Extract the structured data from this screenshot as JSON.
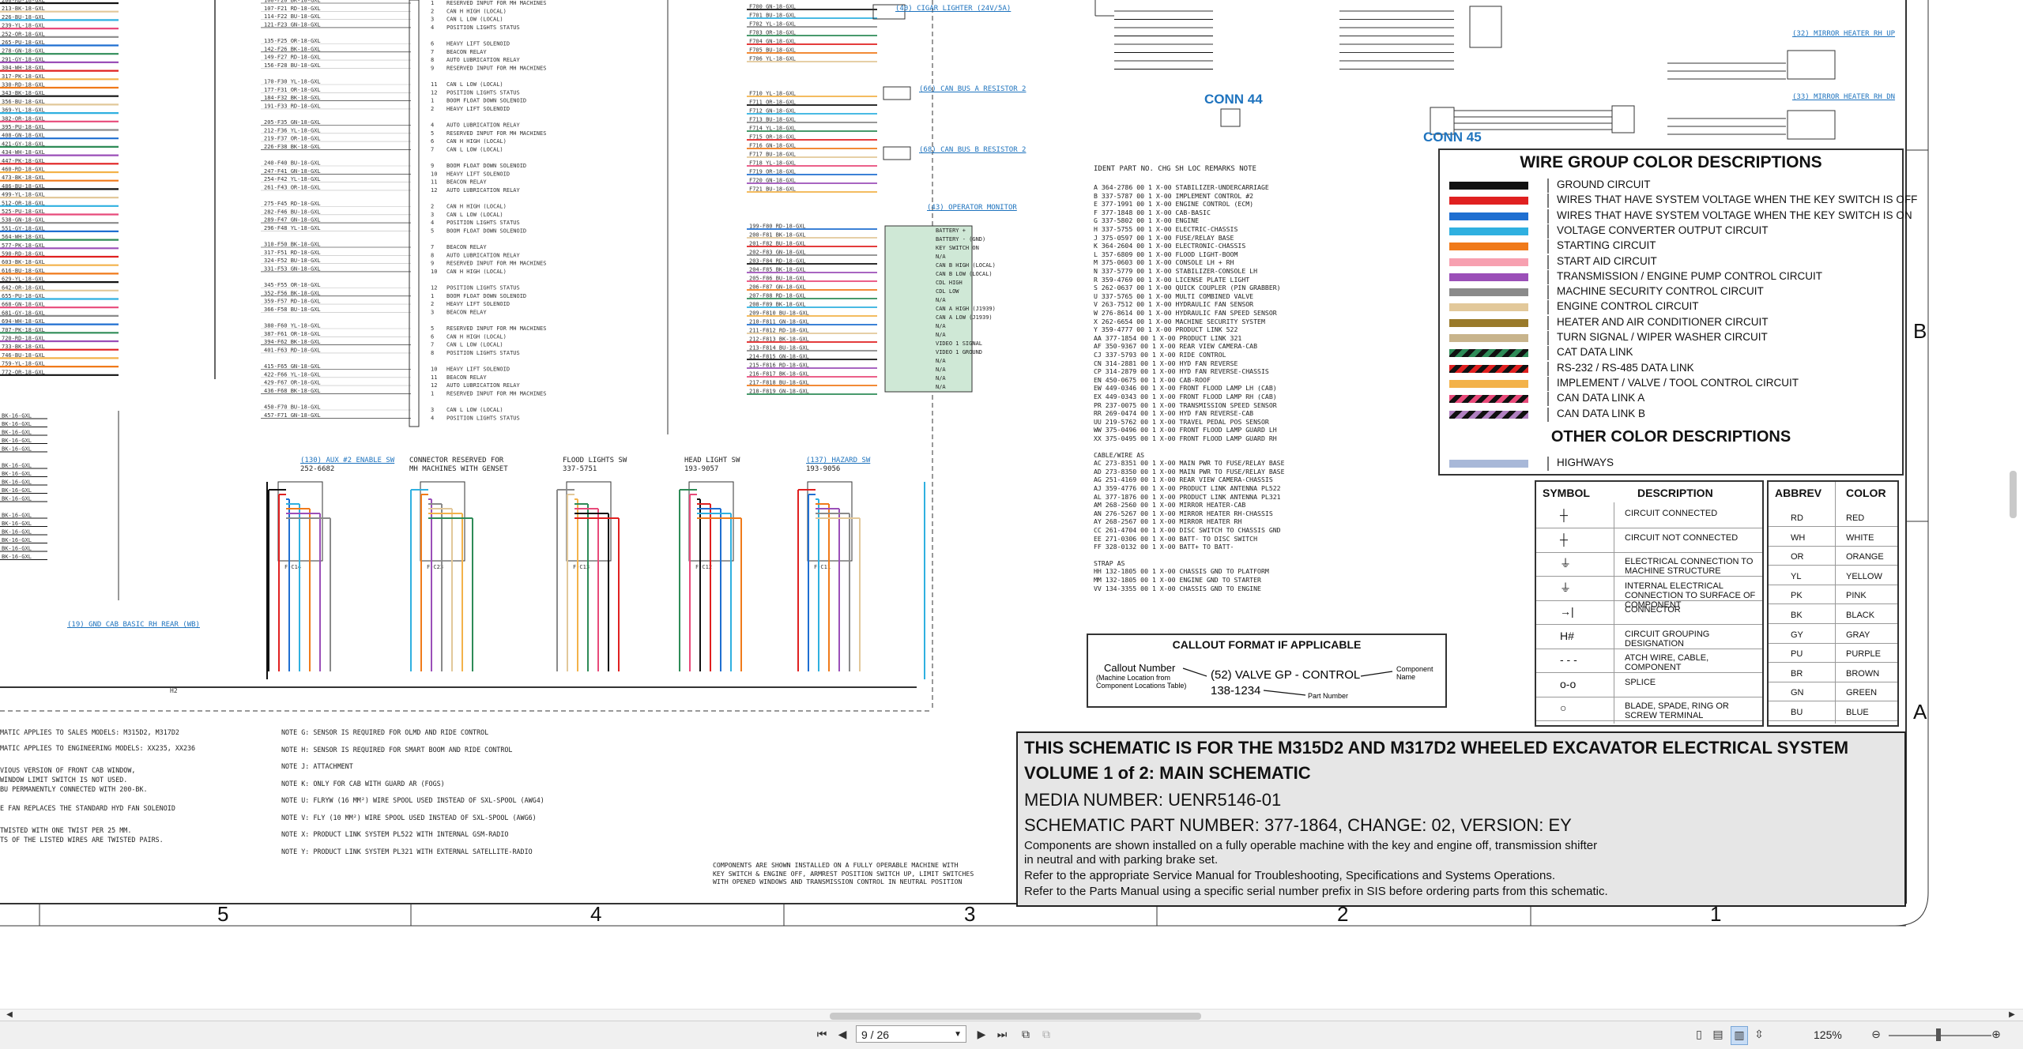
{
  "wire_groups": {
    "title": "WIRE GROUP COLOR DESCRIPTIONS",
    "rows": [
      {
        "label": "GROUND CIRCUIT",
        "c1": "#111111",
        "c2": "#111111"
      },
      {
        "label": "WIRES THAT HAVE SYSTEM VOLTAGE WHEN THE KEY SWITCH IS OFF",
        "c1": "#e02020",
        "c2": "#e02020"
      },
      {
        "label": "WIRES THAT HAVE SYSTEM VOLTAGE WHEN THE KEY SWITCH IS ON",
        "c1": "#1f6fd1",
        "c2": "#1f6fd1"
      },
      {
        "label": "VOLTAGE CONVERTER OUTPUT CIRCUIT",
        "c1": "#2fb0e0",
        "c2": "#2fb0e0"
      },
      {
        "label": "STARTING CIRCUIT",
        "c1": "#f07a1a",
        "c2": "#f07a1a"
      },
      {
        "label": "START AID CIRCUIT",
        "c1": "#f7a0b0",
        "c2": "#f7a0b0"
      },
      {
        "label": "TRANSMISSION / ENGINE PUMP CONTROL CIRCUIT",
        "c1": "#9b4fb8",
        "c2": "#9b4fb8"
      },
      {
        "label": "MACHINE SECURITY CONTROL CIRCUIT",
        "c1": "#8a8a8a",
        "c2": "#8a8a8a"
      },
      {
        "label": "ENGINE CONTROL CIRCUIT",
        "c1": "#e2c89a",
        "c2": "#e2c89a"
      },
      {
        "label": "HEATER AND AIR CONDITIONER CIRCUIT",
        "c1": "#9a7a2a",
        "c2": "#9a7a2a"
      },
      {
        "label": "TURN SIGNAL / WIPER WASHER CIRCUIT",
        "c1": "#c8b48c",
        "c2": "#c8b48c"
      },
      {
        "label": "CAT DATA LINK",
        "c1": "#2e8b57",
        "c2": "#111111"
      },
      {
        "label": "RS-232 / RS-485 DATA LINK",
        "c1": "#e02020",
        "c2": "#111111"
      },
      {
        "label": "IMPLEMENT / VALVE / TOOL CONTROL CIRCUIT",
        "c1": "#f3b24a",
        "c2": "#f3b24a"
      },
      {
        "label": "CAN DATA LINK A",
        "c1": "#e84a7a",
        "c2": "#111111"
      },
      {
        "label": "CAN DATA LINK B",
        "c1": "#b080c0",
        "c2": "#111111"
      }
    ],
    "other_title": "OTHER COLOR DESCRIPTIONS",
    "other_rows": [
      {
        "label": "HIGHWAYS",
        "c1": "#a8b8d8",
        "c2": "#a8b8d8"
      }
    ]
  },
  "symbols": {
    "header_symbol": "SYMBOL",
    "header_desc": "DESCRIPTION",
    "rows": [
      {
        "icon": "circuit-connected-icon",
        "label": "CIRCUIT CONNECTED"
      },
      {
        "icon": "circuit-not-connected-icon",
        "label": "CIRCUIT NOT CONNECTED"
      },
      {
        "icon": "machine-ground-icon",
        "label": "ELECTRICAL CONNECTION TO MACHINE STRUCTURE"
      },
      {
        "icon": "component-ground-icon",
        "label": "INTERNAL ELECTRICAL CONNECTION TO SURFACE OF COMPONENT"
      },
      {
        "icon": "connector-icon",
        "label": "CONNECTOR"
      },
      {
        "icon": "circuit-grouping-icon",
        "label": "CIRCUIT GROUPING DESIGNATION"
      },
      {
        "icon": "attach-wire-icon",
        "label": "ATCH WIRE, CABLE, COMPONENT"
      },
      {
        "icon": "splice-icon",
        "label": "SPLICE"
      },
      {
        "icon": "terminal-icon",
        "label": "BLADE, SPADE, RING OR SCREW TERMINAL"
      }
    ]
  },
  "abbreviations": {
    "header_abbrev": "ABBREV",
    "header_color": "COLOR",
    "rows": [
      [
        "RD",
        "RED"
      ],
      [
        "WH",
        "WHITE"
      ],
      [
        "OR",
        "ORANGE"
      ],
      [
        "YL",
        "YELLOW"
      ],
      [
        "PK",
        "PINK"
      ],
      [
        "BK",
        "BLACK"
      ],
      [
        "GY",
        "GRAY"
      ],
      [
        "PU",
        "PURPLE"
      ],
      [
        "BR",
        "BROWN"
      ],
      [
        "GN",
        "GREEN"
      ],
      [
        "BU",
        "BLUE"
      ]
    ]
  },
  "callout": {
    "title": "CALLOUT FORMAT IF APPLICABLE",
    "callout_number": "Callout Number",
    "machine_location": "(Machine Location from",
    "component_locations": "Component Locations Table)",
    "example": "(52) VALVE GP - CONTROL",
    "part_example": "138-1234",
    "component_name": "Component Name",
    "part_number": "Part Number"
  },
  "title_block": {
    "line1": "THIS SCHEMATIC IS FOR THE M315D2 AND M317D2  WHEELED EXCAVATOR ELECTRICAL SYSTEM",
    "line2": "VOLUME 1 of 2: MAIN SCHEMATIC",
    "media": "MEDIA NUMBER: UENR5146-01",
    "part": "SCHEMATIC PART NUMBER: 377-1864, CHANGE: 02, VERSION: EY",
    "note1": "Components are shown installed on a fully operable machine with the key and engine off, transmission shifter",
    "note2": "in neutral and with parking brake set.",
    "note3": "Refer to the appropriate Service Manual for Troubleshooting, Specifications and Systems Operations.",
    "note4": "Refer to the Parts Manual using a specific serial number prefix in SIS before ordering parts from this schematic."
  },
  "zones": {
    "bottom": [
      "5",
      "4",
      "3",
      "2",
      "1"
    ],
    "right": [
      "B",
      "A"
    ]
  },
  "conn_labels": {
    "conn44": "CONN 44",
    "conn45": "CONN 45"
  },
  "links": {
    "cigar": "(40) CIGAR LIGHTER (24V/5A)",
    "can_resistor_a": "(66) CAN BUS A RESISTOR 2",
    "can_resistor_b": "(68) CAN BUS B RESISTOR 2",
    "operator_monitor": "(43) OPERATOR MONITOR",
    "aux_enable": "(130) AUX #2 ENABLE SW",
    "hazard": "(137) HAZARD SW",
    "gnd_cab": "(19) GND CAB BASIC RH REAR (WB)",
    "mirror_upper": "(32) MIRROR HEATER RH UP",
    "mirror_lower": "(33) MIRROR HEATER RH DN"
  },
  "switch_labels": {
    "reserved": "CONNECTOR RESERVED FOR",
    "reserved2": "MH MACHINES WITH GENSET",
    "flood": "FLOOD LIGHTS SW",
    "head": "HEAD LIGHT SW",
    "flood_pn": "337-5751",
    "head_pn": "193-9057",
    "hazard_pn": "193-9056",
    "aux_pn": "252-6682"
  },
  "notes_left": [
    "MATIC APPLIES TO SALES MODELS: M315D2, M317D2",
    "MATIC APPLIES TO ENGINEERING MODELS: XX235, XX236",
    "VIOUS VERSION OF FRONT CAB WINDOW,",
    "WINDOW LIMIT SWITCH IS NOT USED.",
    "BU PERMANENTLY CONNECTED WITH 200-BK.",
    "E FAN REPLACES THE STANDARD HYD FAN SOLENOID",
    "TWISTED WITH ONE TWIST PER 25 MM.",
    "TS OF THE LISTED WIRES ARE TWISTED PAIRS."
  ],
  "notes_mid": [
    "NOTE G: SENSOR IS REQUIRED FOR OLMD AND RIDE CONTROL",
    "NOTE H: SENSOR IS REQUIRED FOR SMART BOOM AND RIDE CONTROL",
    "NOTE J: ATTACHMENT",
    "NOTE K: ONLY FOR CAB WITH GUARD AR (FOGS)",
    "NOTE U: FLRYW (16 MM²) WIRE SPOOL USED INSTEAD OF SXL-SPOOL (AWG4)",
    "NOTE V: FLY (10 MM²) WIRE SPOOL USED INSTEAD OF SXL-SPOOL (AWG6)",
    "NOTE X: PRODUCT LINK SYSTEM PL522 WITH INTERNAL GSM-RADIO",
    "NOTE Y: PRODUCT LINK SYSTEM PL321 WITH EXTERNAL SATELLITE-RADIO"
  ],
  "components_note": [
    "COMPONENTS ARE SHOWN INSTALLED ON A FULLY OPERABLE MACHINE WITH",
    "KEY SWITCH & ENGINE OFF, ARMREST POSITION SWITCH UP, LIMIT SWITCHES",
    "WITH OPENED WINDOWS AND TRANSMISSION CONTROL IN NEUTRAL POSITION"
  ],
  "parts_table": {
    "headers": "IDENT  PART NO.   CHG  SH  LOC   REMARKS                        NOTE",
    "rows": [
      "A      364-2786    00   1   X-00  STABILIZER-UNDERCARRIAGE",
      "B      337-5787    00   1   X-00  IMPLEMENT CONTROL #2",
      "E      377-1991    00   1   X-00  ENGINE CONTROL (ECM)",
      "F      377-1848    00   1   X-00  CAB-BASIC",
      "G      337-5802    00   1   X-00  ENGINE",
      "H      337-5755    00   1   X-00  ELECTRIC-CHASSIS",
      "J      375-0597    00   1   X-00  FUSE/RELAY BASE",
      "K      364-2604    00   1   X-00  ELECTRONIC-CHASSIS",
      "L      357-6809    00   1   X-00  FLOOD LIGHT-BOOM",
      "M      375-0603    00   1   X-00  CONSOLE LH + RH",
      "N      337-5779    00   1   X-00  STABILIZER-CONSOLE LH",
      "R      359-4769    00   1   X-00  LICENSE PLATE LIGHT",
      "S      262-0637    00   1   X-00  QUICK COUPLER (PIN GRABBER)",
      "U      337-5765    00   1   X-00  MULTI COMBINED VALVE",
      "V      263-7512    00   1   X-00  HYDRAULIC FAN SENSOR",
      "W      276-8614    00   1   X-00  HYDRAULIC FAN SPEED SENSOR",
      "X      262-6654    00   1   X-00  MACHINE SECURITY SYSTEM",
      "Y      359-4777    00   1   X-00  PRODUCT LINK 522",
      "AA     377-1854    00   1   X-00  PRODUCT LINK 321",
      "AF     350-9367    00   1   X-00  REAR VIEW CAMERA-CAB",
      "CJ     337-5793    00   1   X-00  RIDE CONTROL",
      "CN     314-2881    00   1   X-00  HYD FAN REVERSE",
      "CP     314-2879    00   1   X-00  HYD FAN REVERSE-CHASSIS",
      "EN     450-0675    00   1   X-00  CAB-ROOF",
      "EW     449-0346    00   1   X-00  FRONT FLOOD LAMP LH (CAB)",
      "EX     449-0343    00   1   X-00  FRONT FLOOD LAMP RH (CAB)",
      "PR     237-0075    00   1   X-00  TRANSMISSION SPEED SENSOR",
      "RR     269-0474    00   1   X-00  HYD FAN REVERSE-CAB",
      "UU     219-5762    00   1   X-00  TRAVEL PEDAL POS SENSOR",
      "WW     375-0496    00   1   X-00  FRONT FLOOD LAMP GUARD LH",
      "XX     375-0495    00   1   X-00  FRONT FLOOD LAMP GUARD RH"
    ],
    "cable_header": "CABLE/WIRE AS",
    "cable_rows": [
      "AC     273-8351    00   1   X-00  MAIN PWR TO FUSE/RELAY BASE",
      "AD     273-8350    00   1   X-00  MAIN PWR TO FUSE/RELAY BASE",
      "AG     251-4169    00   1   X-00  REAR VIEW CAMERA-CHASSIS",
      "AJ     359-4776    00   1   X-00  PRODUCT LINK ANTENNA PL522",
      "AL     377-1876    00   1   X-00  PRODUCT LINK ANTENNA PL321",
      "AM     268-2560    00   1   X-00  MIRROR HEATER-CAB",
      "AN     276-5267    00   1   X-00  MIRROR HEATER RH-CHASSIS",
      "AY     268-2567    00   1   X-00  MIRROR HEATER RH",
      "CC     261-4704    00   1   X-00  DISC SWITCH TO CHASSIS GND",
      "EE     271-0306    00   1   X-00  BATT- TO DISC SWITCH",
      "FF     328-0132    00   1   X-00  BATT+ TO BATT-"
    ],
    "strap_header": "STRAP AS",
    "strap_rows": [
      "HH     132-1805    00   1   X-00  CHASSIS GND TO PLATFORM",
      "MM     132-1805    00   1   X-00  ENGINE GND TO STARTER",
      "VV     134-3355    00   1   X-00  CHASSIS GND TO ENGINE"
    ]
  },
  "toolbar": {
    "page_value": "9 / 26",
    "zoom": "125%"
  }
}
